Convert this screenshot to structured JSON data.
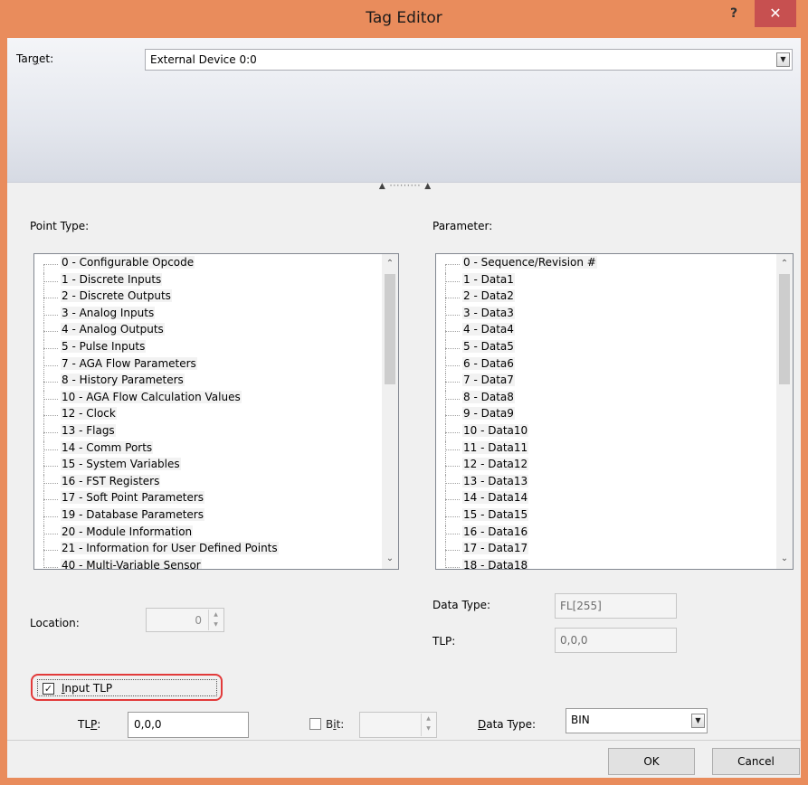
{
  "window": {
    "title": "Tag Editor",
    "help": "?",
    "close": "✕"
  },
  "target": {
    "label_pre": "Tar",
    "label_key": "g",
    "label_post": "et:",
    "value": "External Device 0:0"
  },
  "splitter": "▲ ········· ▲",
  "point_type": {
    "label": "Point Type:",
    "items": [
      "0 - Configurable Opcode",
      "1 - Discrete Inputs",
      "2 - Discrete Outputs",
      "3 - Analog Inputs",
      "4 - Analog Outputs",
      "5 - Pulse Inputs",
      "7 - AGA Flow Parameters",
      "8 - History Parameters",
      "10 - AGA Flow Calculation Values",
      "12 - Clock",
      "13 - Flags",
      "14 - Comm Ports",
      "15 - System Variables",
      "16 - FST Registers",
      "17 - Soft Point Parameters",
      "19 - Database Parameters",
      "20 - Module Information",
      "21 - Information for User Defined Points",
      "40 - Multi-Variable Sensor"
    ]
  },
  "parameter": {
    "label": "Parameter:",
    "items": [
      "0 - Sequence/Revision #",
      "1 - Data1",
      "2 - Data2",
      "3 - Data3",
      "4 - Data4",
      "5 - Data5",
      "6 - Data6",
      "7 - Data7",
      "8 - Data8",
      "9 - Data9",
      "10 - Data10",
      "11 - Data11",
      "12 - Data12",
      "13 - Data13",
      "14 - Data14",
      "15 - Data15",
      "16 - Data16",
      "17 - Data17",
      "18 - Data18"
    ]
  },
  "location": {
    "label": "Location:",
    "value": "0"
  },
  "readonly": {
    "data_type_label": "Data Type:",
    "data_type_value": "FL[255]",
    "tlp_label": "TLP:",
    "tlp_value": "0,0,0"
  },
  "input_tlp": {
    "checked": true,
    "label_key": "I",
    "label_rest": "nput TLP"
  },
  "tlp_input": {
    "label_pre": "TL",
    "label_key": "P",
    "label_post": ":",
    "value": "0,0,0"
  },
  "bit": {
    "label_pre": "B",
    "label_key": "i",
    "label_post": "t:",
    "checked": false
  },
  "data_type": {
    "label_key": "D",
    "label_rest": "ata Type:",
    "value": "BIN"
  },
  "buttons": {
    "ok": "OK",
    "cancel": "Cancel"
  },
  "colors": {
    "titlebar": "#e98c5c",
    "close": "#c75050",
    "highlight_ring": "#e23a3a"
  }
}
